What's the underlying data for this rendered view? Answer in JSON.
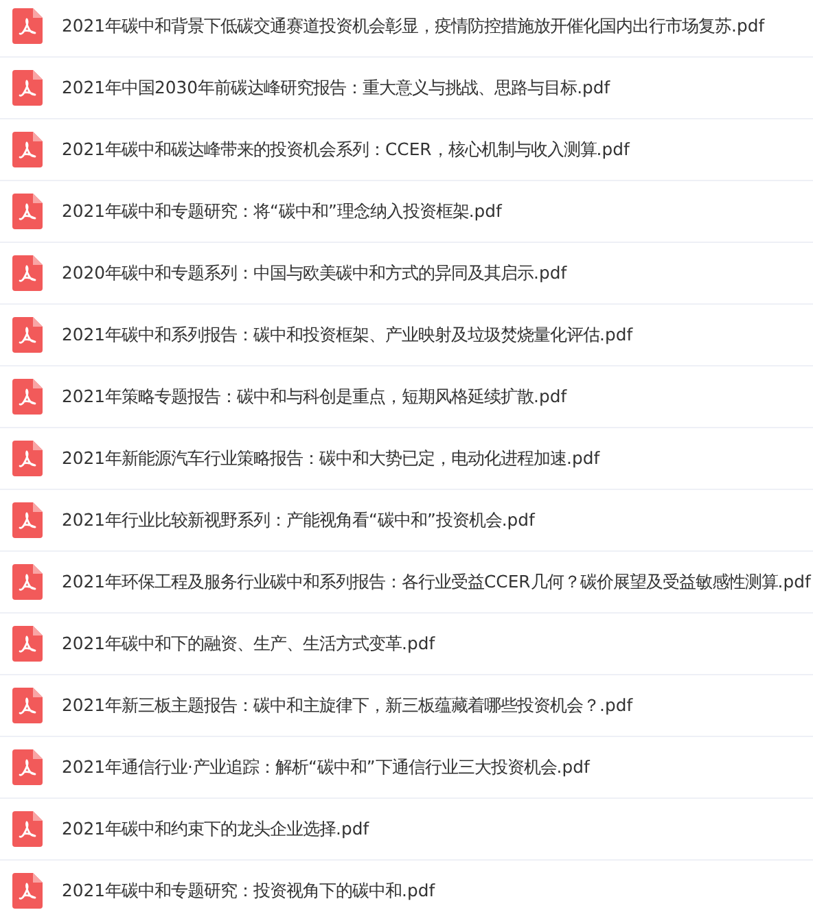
{
  "files": [
    {
      "name": "2021年碳中和背景下低碳交通赛道投资机会彰显，疫情防控措施放开催化国内出行市场复苏.pdf"
    },
    {
      "name": "2021年中国2030年前碳达峰研究报告：重大意义与挑战、思路与目标.pdf"
    },
    {
      "name": "2021年碳中和碳达峰带来的投资机会系列：CCER，核心机制与收入测算.pdf"
    },
    {
      "name": "2021年碳中和专题研究：将“碳中和”理念纳入投资框架.pdf"
    },
    {
      "name": "2020年碳中和专题系列：中国与欧美碳中和方式的异同及其启示.pdf"
    },
    {
      "name": "2021年碳中和系列报告：碳中和投资框架、产业映射及垃圾焚烧量化评估.pdf"
    },
    {
      "name": "2021年策略专题报告：碳中和与科创是重点，短期风格延续扩散.pdf"
    },
    {
      "name": "2021年新能源汽车行业策略报告：碳中和大势已定，电动化进程加速.pdf"
    },
    {
      "name": "2021年行业比较新视野系列：产能视角看“碳中和”投资机会.pdf"
    },
    {
      "name": "2021年环保工程及服务行业碳中和系列报告：各行业受益CCER几何？碳价展望及受益敏感性测算.pdf"
    },
    {
      "name": "2021年碳中和下的融资、生产、生活方式变革.pdf"
    },
    {
      "name": "2021年新三板主题报告：碳中和主旋律下，新三板蕴藏着哪些投资机会？.pdf"
    },
    {
      "name": "2021年通信行业·产业追踪：解析“碳中和”下通信行业三大投资机会.pdf"
    },
    {
      "name": "2021年碳中和约束下的龙头企业选择.pdf"
    },
    {
      "name": "2021年碳中和专题研究：投资视角下的碳中和.pdf"
    }
  ]
}
